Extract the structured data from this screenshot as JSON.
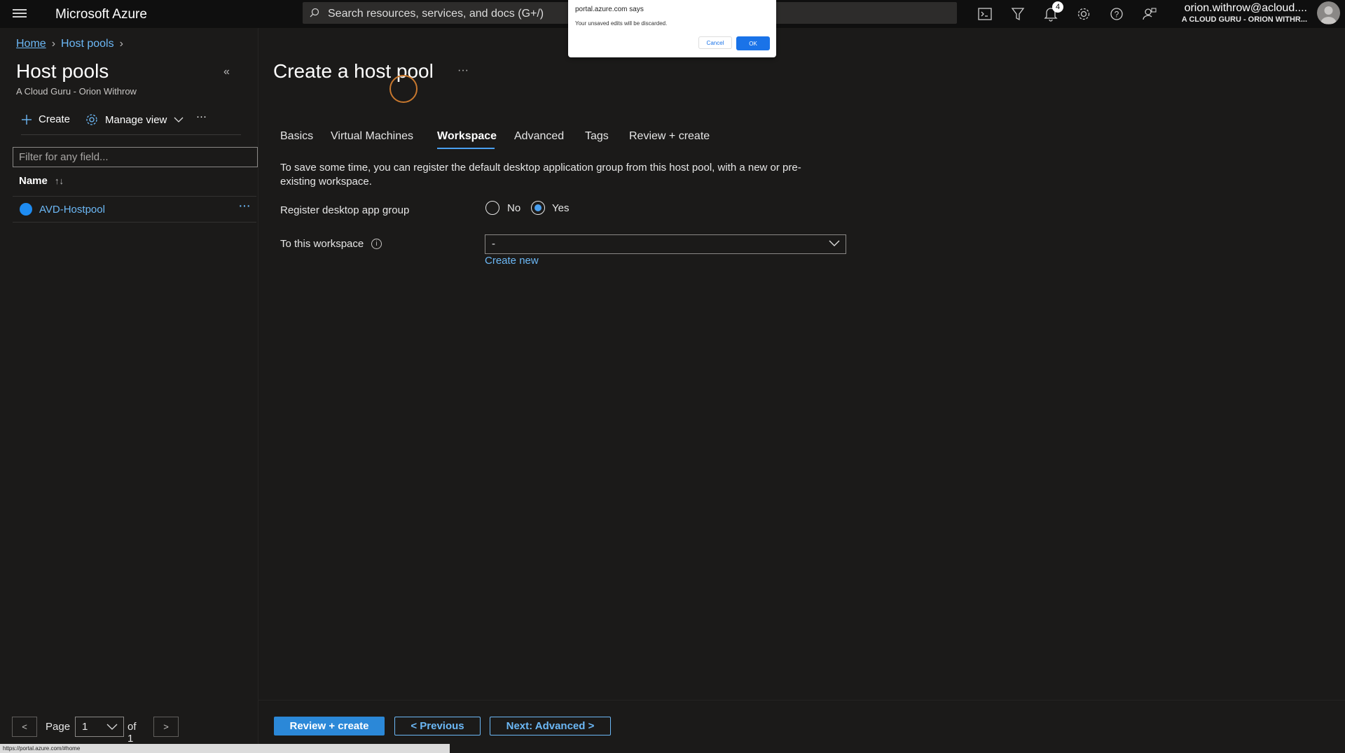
{
  "topbar": {
    "brand": "Microsoft Azure",
    "search_placeholder": "Search resources, services, and docs (G+/)",
    "notification_count": "4",
    "account_email": "orion.withrow@acloud....",
    "account_org": "A CLOUD GURU - ORION WITHR...",
    "icons": [
      "cloud-shell-icon",
      "directory-filter-icon",
      "bell-icon",
      "gear-icon",
      "help-icon",
      "feedback-icon"
    ]
  },
  "breadcrumb": {
    "home": "Home",
    "current": "Host pools"
  },
  "left": {
    "title": "Host pools",
    "subtitle": "A Cloud Guru - Orion Withrow",
    "collapse": "«",
    "create": "Create",
    "manage_view": "Manage view",
    "more": "···",
    "filter_placeholder": "Filter for any field...",
    "col_name": "Name",
    "sort_icon": "↑↓",
    "rows": [
      {
        "name": "AVD-Hostpool",
        "more": "···"
      }
    ],
    "pager": {
      "prev": "<",
      "page_label": "Page",
      "page_value": "1",
      "of_label": "of 1",
      "next": ">"
    }
  },
  "main": {
    "title": "Create a host pool",
    "more": "···",
    "tabs": [
      "Basics",
      "Virtual Machines",
      "Workspace",
      "Advanced",
      "Tags",
      "Review + create"
    ],
    "active_tab": "Workspace",
    "description": "To save some time, you can register the default desktop application group from this host pool, with a new or pre-existing workspace.",
    "register_label": "Register desktop app group",
    "radio_no": "No",
    "radio_yes": "Yes",
    "selected_radio": "Yes",
    "workspace_label": "To this workspace",
    "workspace_value": "-",
    "create_new": "Create new"
  },
  "footer": {
    "review_create": "Review + create",
    "previous": "< Previous",
    "next": "Next: Advanced >"
  },
  "status_url": "https://portal.azure.com/#home",
  "dialog": {
    "title": "portal.azure.com says",
    "message": "Your unsaved edits will be discarded.",
    "cancel": "Cancel",
    "ok": "OK"
  },
  "colors": {
    "accent": "#2b88d8",
    "link": "#6cb8f6",
    "background": "#1b1a19",
    "topbar": "#0f0f0f"
  }
}
